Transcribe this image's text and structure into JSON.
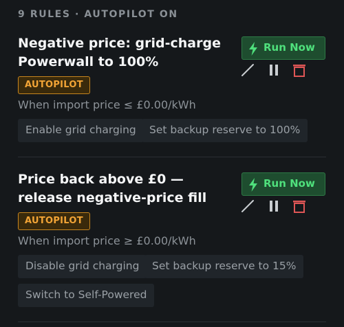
{
  "header": {
    "text": "9 RULES · AUTOPILOT ON"
  },
  "rules": [
    {
      "title_line1": "Negative price: grid-charge",
      "title_line2": "Powerwall to 100%",
      "badge": "AUTOPILOT",
      "condition": "When import price ≤ £0.00/kWh",
      "actions": [
        "Enable grid charging",
        "Set backup reserve to 100%"
      ],
      "run_label": "Run Now"
    },
    {
      "title_line1": "Price back above £0 —",
      "title_line2": "release negative-price fill",
      "badge": "AUTOPILOT",
      "condition": "When import price ≥ £0.00/kWh",
      "actions": [
        "Disable grid charging",
        "Set backup reserve to 15%",
        "Switch to Self-Powered"
      ],
      "run_label": "Run Now"
    }
  ],
  "colors": {
    "background": "#15181b",
    "accent_green": "#4fe07c",
    "badge_orange": "#f2a436",
    "delete_red": "#e05656"
  },
  "icons": [
    "bolt-icon",
    "edit-icon",
    "pause-icon",
    "delete-icon"
  ]
}
